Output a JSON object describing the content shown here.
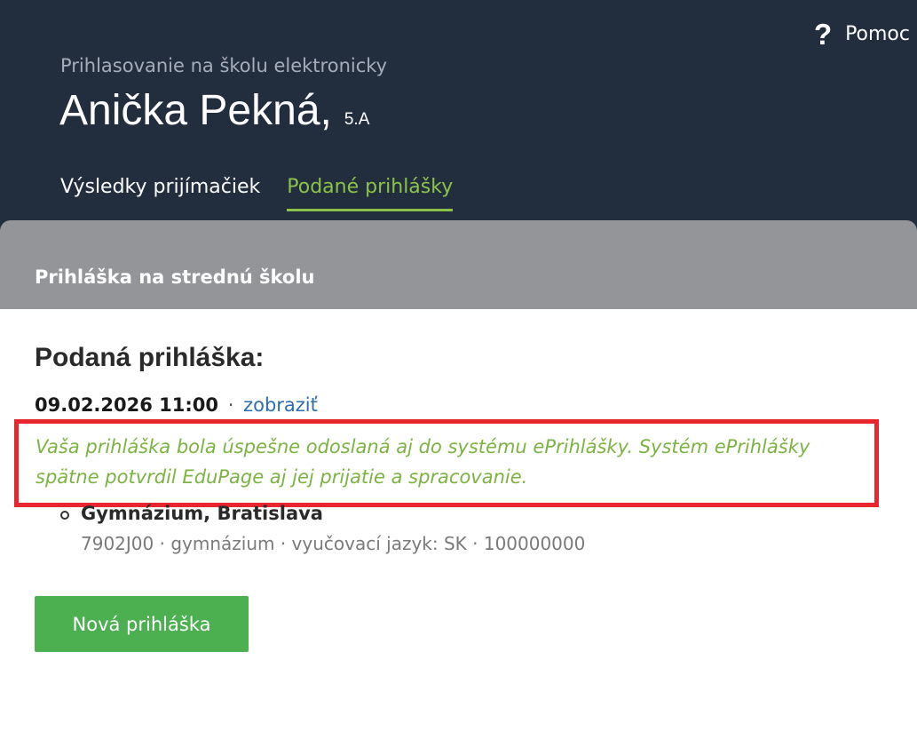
{
  "header": {
    "help_icon": "?",
    "help_label": "Pomoc",
    "subtitle": "Prihlasovanie na školu elektronicky",
    "student_name": "Anička Pekná,",
    "student_class": "5.A",
    "tabs": [
      {
        "label": "Výsledky prijímačiek",
        "active": false
      },
      {
        "label": "Podané prihlášky",
        "active": true
      }
    ]
  },
  "section": {
    "title": "Prihláška na strednú školu"
  },
  "application": {
    "heading": "Podaná prihláška:",
    "date": "09.02.2026 11:00",
    "separator": "·",
    "view_link": "zobraziť",
    "notice": "Vaša prihláška bola úspešne odoslaná aj do systému ePrihlášky. Systém ePrihlášky spätne potvrdil EduPage aj jej prijatie a spracovanie.",
    "school_name": "Gymnázium, Bratislava",
    "school_meta": "7902J00 · gymnázium · vyučovací jazyk: SK · 100000000"
  },
  "actions": {
    "new_application_label": "Nová prihláška"
  },
  "colors": {
    "header_bg": "#222e3e",
    "accent_green": "#8bc34a",
    "notice_green": "#7cb342",
    "highlight_red": "#e8262d",
    "button_green": "#4caf50",
    "section_gray": "#939598",
    "link_blue": "#2f6db0"
  }
}
